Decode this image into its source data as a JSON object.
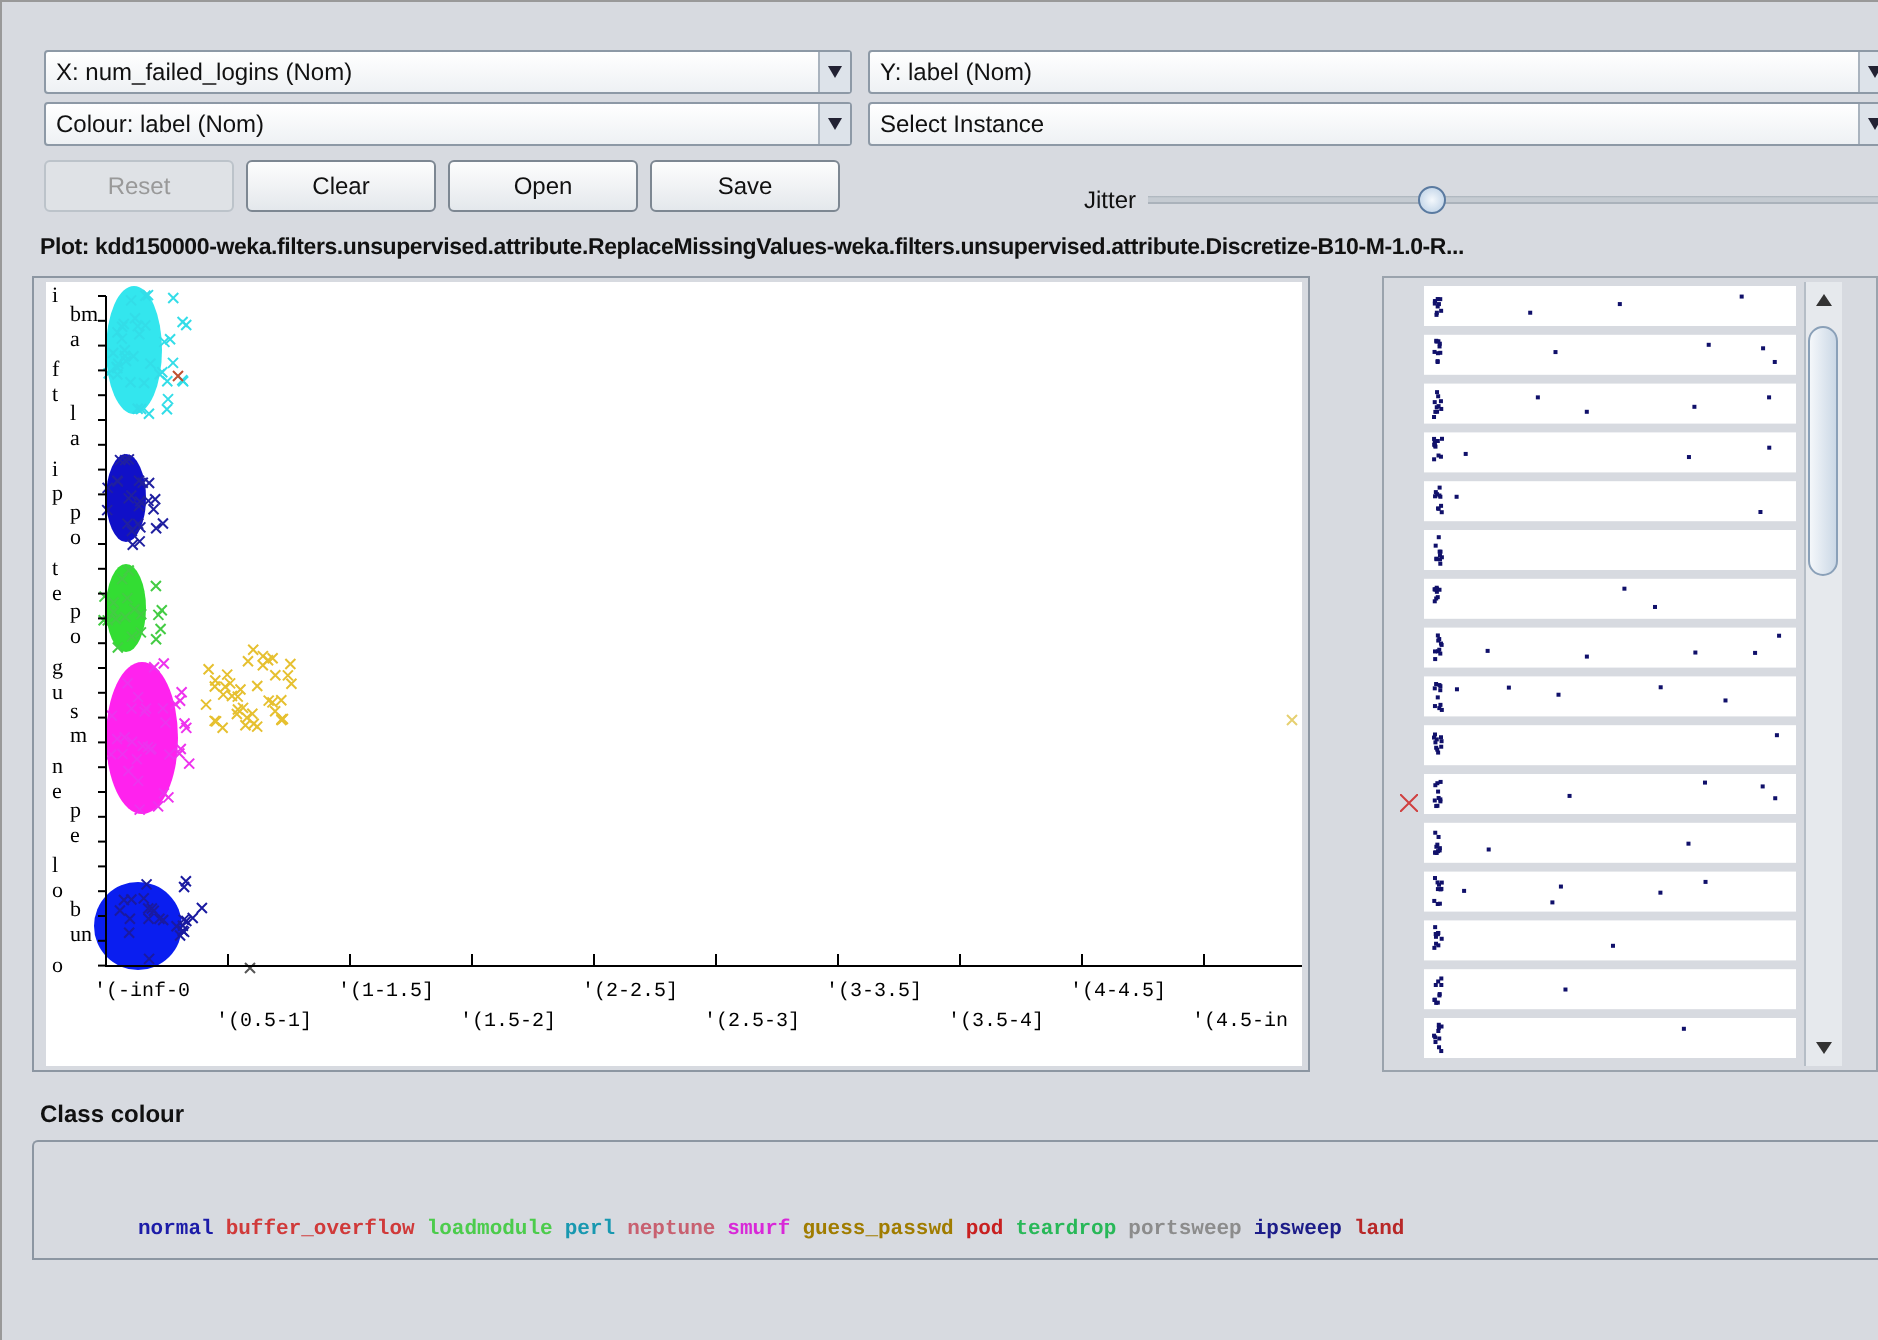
{
  "selectors": [
    {
      "label": "X: num_failed_logins (Nom)"
    },
    {
      "label": "Y: label (Nom)"
    },
    {
      "label": "Colour: label (Nom)"
    },
    {
      "label": "Select Instance"
    }
  ],
  "buttons": [
    {
      "label": "Reset",
      "disabled": true
    },
    {
      "label": "Clear",
      "disabled": false
    },
    {
      "label": "Open",
      "disabled": false
    },
    {
      "label": "Save",
      "disabled": false
    }
  ],
  "jitter": {
    "label": "Jitter",
    "level": 0.39
  },
  "plot_title": "Plot: kdd150000-weka.filters.unsupervised.attribute.ReplaceMissingValues-weka.filters.unsupervised.attribute.Discretize-B10-M-1.0-R...",
  "y_labels": [
    "i",
    "bm",
    "a",
    "f",
    "t",
    "l",
    "a",
    "i",
    "p",
    "p",
    "o",
    "t",
    "e",
    "p",
    "o",
    "g",
    "u",
    "s",
    "m",
    "n",
    "e",
    "p",
    "e",
    "l",
    "o",
    "b",
    "un",
    "o"
  ],
  "x_labels": [
    "'(-inf-0",
    "'(0.5-1]",
    "'(1-1.5]",
    "'(1.5-2]",
    "'(2-2.5]",
    "'(2.5-3]",
    "'(3-3.5]",
    "'(3.5-4]",
    "'(4-4.5]",
    "'(4.5-in"
  ],
  "class_colour": {
    "title": "Class colour",
    "classes": [
      {
        "name": "normal",
        "color": "#1c1ca8"
      },
      {
        "name": "buffer_overflow",
        "color": "#d03a3a"
      },
      {
        "name": "loadmodule",
        "color": "#4ccc4c"
      },
      {
        "name": "perl",
        "color": "#1898b0"
      },
      {
        "name": "neptune",
        "color": "#c86070"
      },
      {
        "name": "smurf",
        "color": "#d828d8"
      },
      {
        "name": "guess_passwd",
        "color": "#a07c00"
      },
      {
        "name": "pod",
        "color": "#c82020"
      },
      {
        "name": "teardrop",
        "color": "#28b858"
      },
      {
        "name": "portsweep",
        "color": "#8c8c8c"
      },
      {
        "name": "ipsweep",
        "color": "#1c1c88"
      },
      {
        "name": "land",
        "color": "#b82828"
      }
    ]
  }
}
